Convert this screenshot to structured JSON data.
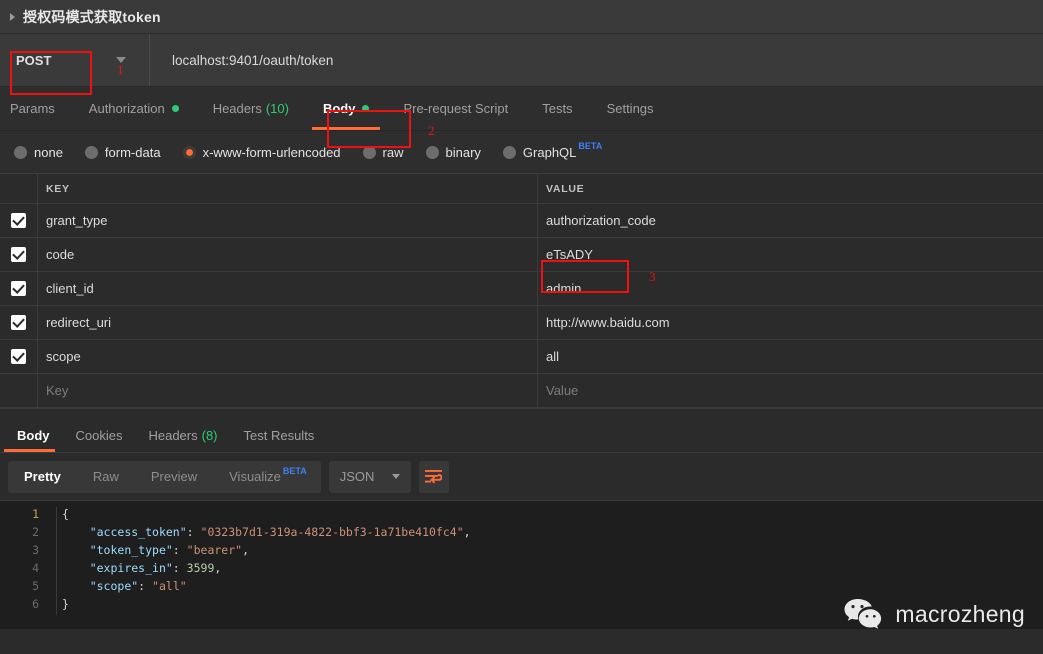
{
  "request": {
    "title": "授权码模式获取token",
    "collapse_icon": "triangle-right-icon",
    "method": "POST",
    "method_chevron_icon": "chevron-down-icon",
    "url": "localhost:9401/oauth/token"
  },
  "request_tabs": [
    {
      "label": "Params",
      "active": false,
      "dot": false,
      "count": ""
    },
    {
      "label": "Authorization",
      "active": false,
      "dot": true,
      "count": ""
    },
    {
      "label": "Headers",
      "active": false,
      "dot": false,
      "count": "(10)"
    },
    {
      "label": "Body",
      "active": true,
      "dot": true,
      "count": ""
    },
    {
      "label": "Pre-request Script",
      "active": false,
      "dot": false,
      "count": ""
    },
    {
      "label": "Tests",
      "active": false,
      "dot": false,
      "count": ""
    },
    {
      "label": "Settings",
      "active": false,
      "dot": false,
      "count": ""
    }
  ],
  "body_types": [
    {
      "label": "none",
      "selected": false,
      "beta": ""
    },
    {
      "label": "form-data",
      "selected": false,
      "beta": ""
    },
    {
      "label": "x-www-form-urlencoded",
      "selected": true,
      "beta": ""
    },
    {
      "label": "raw",
      "selected": false,
      "beta": ""
    },
    {
      "label": "binary",
      "selected": false,
      "beta": ""
    },
    {
      "label": "GraphQL",
      "selected": false,
      "beta": "BETA"
    }
  ],
  "kv_table": {
    "headers": {
      "key": "KEY",
      "value": "VALUE"
    },
    "rows": [
      {
        "checked": true,
        "key": "grant_type",
        "value": "authorization_code"
      },
      {
        "checked": true,
        "key": "code",
        "value": "eTsADY"
      },
      {
        "checked": true,
        "key": "client_id",
        "value": "admin"
      },
      {
        "checked": true,
        "key": "redirect_uri",
        "value": "http://www.baidu.com"
      },
      {
        "checked": true,
        "key": "scope",
        "value": "all"
      }
    ],
    "empty_row": {
      "key_placeholder": "Key",
      "value_placeholder": "Value"
    }
  },
  "response_tabs": [
    {
      "label": "Body",
      "active": true,
      "count": ""
    },
    {
      "label": "Cookies",
      "active": false,
      "count": ""
    },
    {
      "label": "Headers",
      "active": false,
      "count": "(8)"
    },
    {
      "label": "Test Results",
      "active": false,
      "count": ""
    }
  ],
  "format_bar": {
    "segments": [
      {
        "label": "Pretty",
        "active": true,
        "beta": ""
      },
      {
        "label": "Raw",
        "active": false,
        "beta": ""
      },
      {
        "label": "Preview",
        "active": false,
        "beta": ""
      },
      {
        "label": "Visualize",
        "active": false,
        "beta": "BETA"
      }
    ],
    "format_select": "JSON",
    "format_chevron_icon": "chevron-down-icon",
    "wrap_icon": "word-wrap-icon"
  },
  "response_body": {
    "line_numbers": [
      "1",
      "2",
      "3",
      "4",
      "5",
      "6"
    ],
    "json": {
      "access_token": "0323b7d1-319a-4822-bbf3-1a71be410fc4",
      "token_type": "bearer",
      "expires_in": 3599,
      "scope": "all"
    }
  },
  "annotations": [
    {
      "number": "1",
      "target": "method-chevron"
    },
    {
      "number": "2",
      "target": "body-tab"
    },
    {
      "number": "3",
      "target": "code-value-cell"
    }
  ],
  "watermark": {
    "icon": "wechat-icon",
    "text": "macrozheng"
  },
  "colors": {
    "accent": "#ff6c37",
    "ok_dot": "#2ecc71",
    "beta": "#3b82f6",
    "annotation": "#ee1111"
  }
}
